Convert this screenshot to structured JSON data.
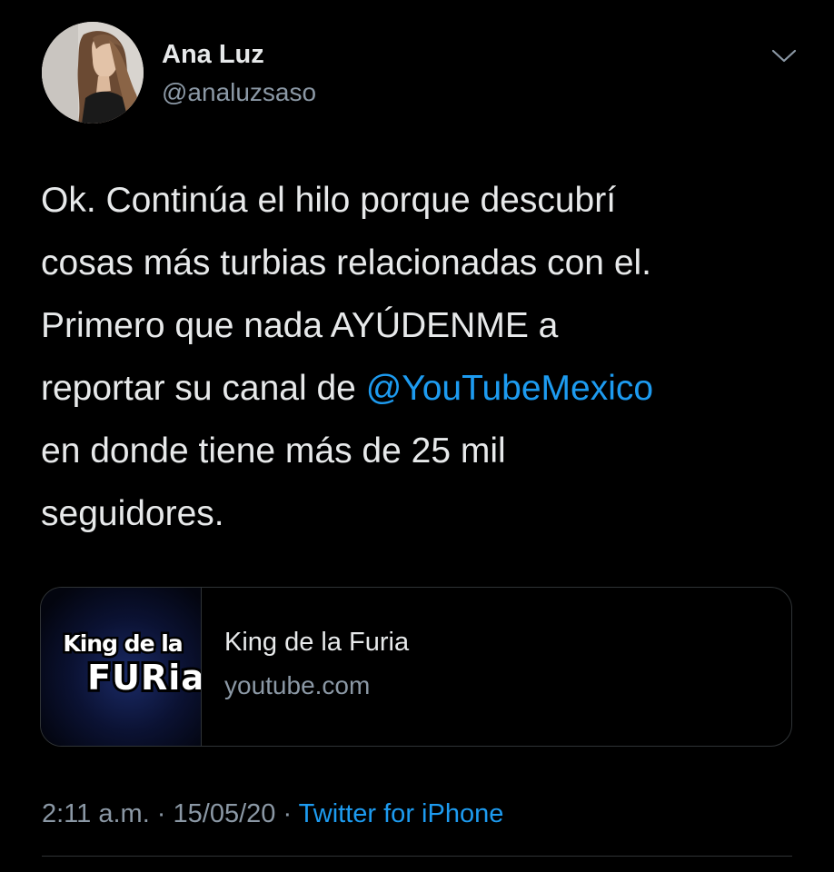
{
  "user": {
    "display_name": "Ana Luz",
    "handle": "@analuzsaso",
    "avatar_icon": "profile-photo"
  },
  "tweet": {
    "lines": [
      "Ok. Continúa el hilo porque descubrí",
      "cosas más turbias relacionadas con el.",
      "Primero que nada AYÚDENME a",
      "reportar su canal de ",
      "en donde tiene más de 25 mil",
      "seguidores."
    ],
    "mention": "@YouTubeMexico"
  },
  "card": {
    "thumb_text_top": "King de la",
    "thumb_text_bottom": "FURia",
    "title": "King de la Furia",
    "domain": "youtube.com"
  },
  "meta": {
    "time": "2:11 a.m.",
    "sep1": " · ",
    "date": "15/05/20",
    "sep2": " · ",
    "source": "Twitter for iPhone"
  },
  "colors": {
    "background": "#000000",
    "text": "#e7e9ea",
    "secondary": "#8b98a5",
    "accent": "#1d9bf0",
    "border": "#2f3336"
  },
  "icons": {
    "menu": "chevron-down-icon"
  }
}
